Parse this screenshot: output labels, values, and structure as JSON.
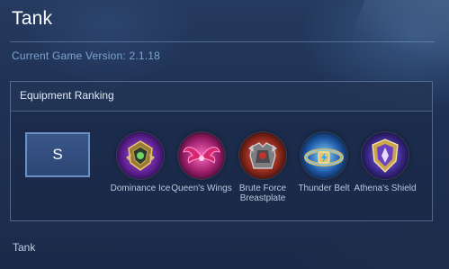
{
  "page": {
    "title": "Tank",
    "game_version": "Current Game Version: 2.1.18",
    "footer_label": "Tank"
  },
  "panel": {
    "header": "Equipment Ranking",
    "rank": "S",
    "items": [
      {
        "name": "Dominance Ice",
        "icon": "dominance-ice-icon"
      },
      {
        "name": "Queen's Wings",
        "icon": "queens-wings-icon"
      },
      {
        "name": "Brute Force Breastplate",
        "icon": "brute-force-breastplate-icon"
      },
      {
        "name": "Thunder Belt",
        "icon": "thunder-belt-icon"
      },
      {
        "name": "Athena's Shield",
        "icon": "athenas-shield-icon"
      }
    ]
  },
  "colors": {
    "background": "#1f3155",
    "accent_text": "#7ea3d1",
    "rank_box": "#3a5688"
  }
}
